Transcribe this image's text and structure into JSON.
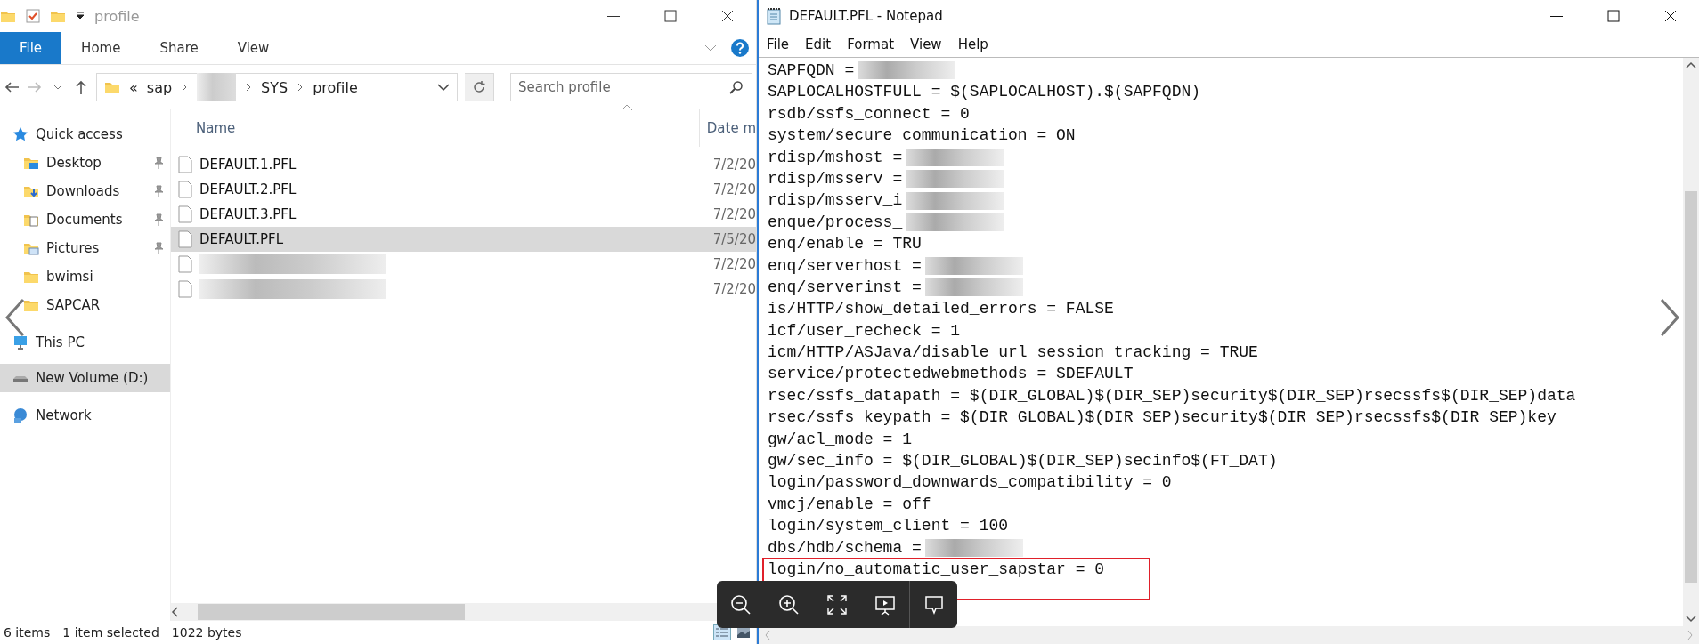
{
  "explorer": {
    "title": "profile",
    "ribbon_tabs": [
      {
        "label": "File",
        "kind": "file"
      },
      {
        "label": "Home",
        "kind": "tab"
      },
      {
        "label": "Share",
        "kind": "tab"
      },
      {
        "label": "View",
        "kind": "tab"
      }
    ],
    "breadcrumbs": [
      {
        "text": "«",
        "kind": "overflow"
      },
      {
        "text": "sap",
        "kind": "crumb"
      },
      {
        "kind": "redacted"
      },
      {
        "text": "SYS",
        "kind": "crumb"
      },
      {
        "text": "profile",
        "kind": "crumb"
      }
    ],
    "search": {
      "placeholder": "Search profile"
    },
    "nav": [
      {
        "label": "Quick access",
        "kind": "quick",
        "pinned": false,
        "selected": false
      },
      {
        "label": "Desktop",
        "kind": "desktop",
        "pinned": true,
        "selected": false
      },
      {
        "label": "Downloads",
        "kind": "downloads",
        "pinned": true,
        "selected": false
      },
      {
        "label": "Documents",
        "kind": "documents",
        "pinned": true,
        "selected": false
      },
      {
        "label": "Pictures",
        "kind": "pictures",
        "pinned": true,
        "selected": false
      },
      {
        "label": "bwimsi",
        "kind": "folder",
        "pinned": false,
        "selected": false
      },
      {
        "label": "SAPCAR",
        "kind": "folder",
        "pinned": false,
        "selected": false
      },
      {
        "label": "This PC",
        "kind": "pc",
        "pinned": false,
        "selected": false
      },
      {
        "label": "New Volume (D:)",
        "kind": "drive",
        "pinned": false,
        "selected": true
      },
      {
        "label": "Network",
        "kind": "network",
        "pinned": false,
        "selected": false
      }
    ],
    "columns": [
      "Name",
      "Date m"
    ],
    "files": [
      {
        "name": "DEFAULT.1.PFL",
        "date": "7/2/20",
        "selected": false,
        "redacted": false
      },
      {
        "name": "DEFAULT.2.PFL",
        "date": "7/2/20",
        "selected": false,
        "redacted": false
      },
      {
        "name": "DEFAULT.3.PFL",
        "date": "7/2/20",
        "selected": false,
        "redacted": false
      },
      {
        "name": "DEFAULT.PFL",
        "date": "7/5/20",
        "selected": true,
        "redacted": false
      },
      {
        "date": "7/2/20",
        "selected": false,
        "redacted": true
      },
      {
        "date": "7/2/20",
        "selected": false,
        "redacted": true
      }
    ],
    "status": {
      "items": "6 items",
      "selection": "1 item selected",
      "size": "1022 bytes"
    }
  },
  "notepad": {
    "title": "DEFAULT.PFL - Notepad",
    "menu": [
      "File",
      "Edit",
      "Format",
      "View",
      "Help"
    ],
    "lines": [
      {
        "text": "SAPFQDN =",
        "redacted": true
      },
      {
        "text": "SAPLOCALHOSTFULL = $(SAPLOCALHOST).$(SAPFQDN)",
        "redacted": false
      },
      {
        "text": "rsdb/ssfs_connect = 0",
        "redacted": false
      },
      {
        "text": "system/secure_communication = ON",
        "redacted": false
      },
      {
        "text": "rdisp/mshost =",
        "redacted": true
      },
      {
        "text": "rdisp/msserv =",
        "redacted": true
      },
      {
        "text": "rdisp/msserv_i",
        "redacted": true
      },
      {
        "text": "enque/process_",
        "redacted": true
      },
      {
        "text": "enq/enable = TRU",
        "redacted": false
      },
      {
        "text": "enq/serverhost =",
        "redacted": true
      },
      {
        "text": "enq/serverinst =",
        "redacted": true
      },
      {
        "text": "is/HTTP/show_detailed_errors = FALSE",
        "redacted": false
      },
      {
        "text": "icf/user_recheck = 1",
        "redacted": false
      },
      {
        "text": "icm/HTTP/ASJava/disable_url_session_tracking = TRUE",
        "redacted": false
      },
      {
        "text": "service/protectedwebmethods = SDEFAULT",
        "redacted": false
      },
      {
        "text": "rsec/ssfs_datapath = $(DIR_GLOBAL)$(DIR_SEP)security$(DIR_SEP)rsecssfs$(DIR_SEP)data",
        "redacted": false
      },
      {
        "text": "rsec/ssfs_keypath = $(DIR_GLOBAL)$(DIR_SEP)security$(DIR_SEP)rsecssfs$(DIR_SEP)key",
        "redacted": false
      },
      {
        "text": "gw/acl_mode = 1",
        "redacted": false
      },
      {
        "text": "gw/sec_info = $(DIR_GLOBAL)$(DIR_SEP)secinfo$(FT_DAT)",
        "redacted": false
      },
      {
        "text": "login/password_downwards_compatibility = 0",
        "redacted": false
      },
      {
        "text": "vmcj/enable = off",
        "redacted": false
      },
      {
        "text": "login/system_client = 100",
        "redacted": false
      },
      {
        "text": "dbs/hdb/schema =",
        "redacted": true
      },
      {
        "text": "login/no_automatic_user_sapstar = 0",
        "redacted": false,
        "highlighted": true
      }
    ]
  },
  "viewer_toolbar": [
    {
      "kind": "zoom-out"
    },
    {
      "kind": "zoom-in"
    },
    {
      "kind": "fit"
    },
    {
      "kind": "slideshow"
    },
    {
      "kind": "comment"
    }
  ]
}
